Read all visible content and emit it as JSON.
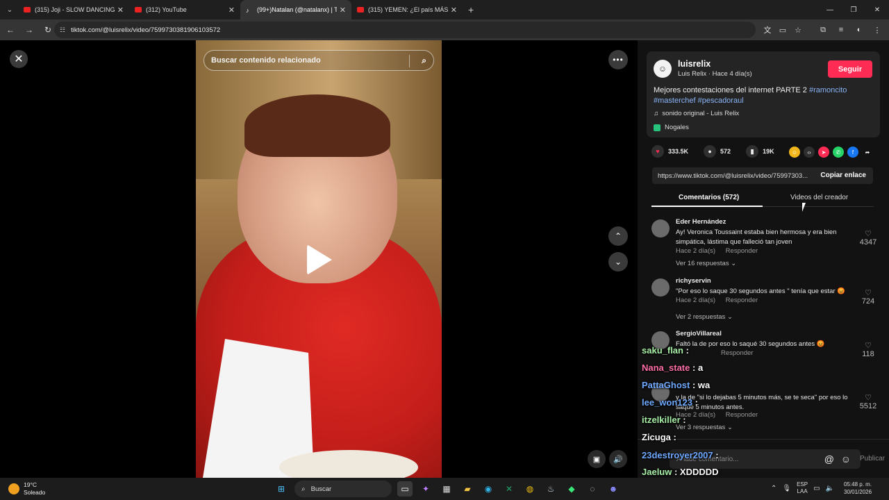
{
  "browser": {
    "tabs": [
      {
        "label": "(315) Joji - SLOW DANCING IN",
        "icon": "youtube-icon"
      },
      {
        "label": "(312) YouTube",
        "icon": "youtube-icon"
      },
      {
        "label": "(99+)Natalan (@natalanx) | Tik",
        "icon": "tiktok-icon"
      },
      {
        "label": "(315) YEMEN: ¿El país MÁS PEL",
        "icon": "youtube-icon"
      }
    ],
    "url": "tiktok.com/@luisrelix/video/7599730381906103572"
  },
  "video": {
    "search_placeholder": "Buscar contenido relacionado"
  },
  "post": {
    "username": "luisrelix",
    "meta": "Luis Relix · Hace 4 día(s)",
    "follow_label": "Seguir",
    "desc_text": "Mejores contestaciones del internet PARTE 2 ",
    "desc_tags": [
      "#ramoncito",
      "#masterchef",
      "#pescadoraul"
    ],
    "sound": "sonido original - Luis Relix",
    "location": "Nogales",
    "likes": "333.5K",
    "comments": "572",
    "saves": "19K",
    "link": "https://www.tiktok.com/@luisrelix/video/75997303...",
    "copy_label": "Copiar enlace"
  },
  "tabs": {
    "comments": "Comentarios (572)",
    "creator": "Videos del creador"
  },
  "comments": [
    {
      "user": "Eder Hernández",
      "text": "Ay! Veronica Toussaint estaba bien hermosa y era bien simpática, lástima que falleció tan joven",
      "time": "Hace 2 día(s)",
      "reply": "Responder",
      "likes": "4347",
      "replies": "Ver 16 respuestas"
    },
    {
      "user": "richyservin",
      "text": "\"Por eso lo saque 30 segundos antes \" tenía que estar 😡",
      "time": "Hace 2 día(s)",
      "reply": "Responder",
      "likes": "724",
      "replies": "Ver 2 respuestas"
    },
    {
      "user": "SergioVillareal",
      "text": "Faltó la de por eso lo saqué 30 segundos antes 😡",
      "time": "",
      "reply": "Responder",
      "likes": "118",
      "replies": ""
    },
    {
      "user": "",
      "text": "y la de \"si lo dejabas 5 minutos más, se te seca\" por eso lo saqué 5 minutos antes.",
      "time": "Hace 2 día(s)",
      "reply": "Responder",
      "likes": "5512",
      "replies": "Ver 3 respuestas"
    }
  ],
  "chat_overlay": [
    {
      "name": "saku_flan",
      "msg": ":"
    },
    {
      "name": "Nana_state",
      "msg": ": a"
    },
    {
      "name": "PattaGhost",
      "msg": ": wa"
    },
    {
      "name": "lee_won123",
      "msg": ":"
    },
    {
      "name": "itzelkiller",
      "msg": ":"
    },
    {
      "name": "Zicuga",
      "msg": ":"
    },
    {
      "name": "23destroyer2007",
      "msg": ":"
    },
    {
      "name": "Jaeluw",
      "msg": ": XDDDDD"
    }
  ],
  "comment_bar": {
    "placeholder": "Añade comentario...",
    "publish": "Publicar"
  },
  "taskbar": {
    "temp": "19°C",
    "weather": "Soleado",
    "search": "Buscar",
    "lang1": "ESP",
    "lang2": "LAA",
    "time": "05:48 p. m.",
    "date": "30/01/2026"
  }
}
